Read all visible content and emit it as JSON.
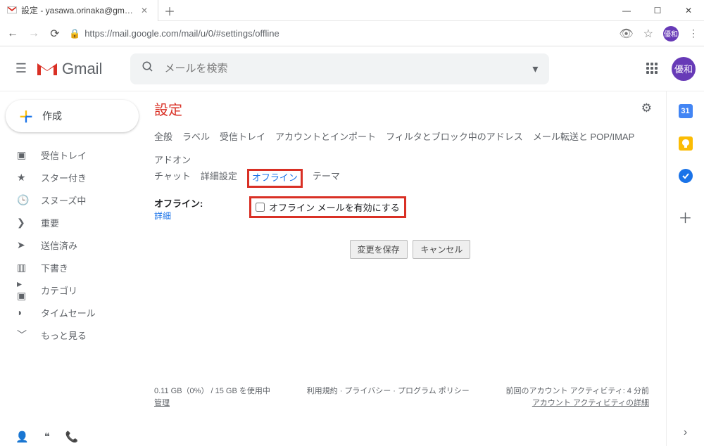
{
  "browser": {
    "tab_title": "設定 - yasawa.orinaka@gmail.co",
    "url": "https://mail.google.com/mail/u/0/#settings/offline",
    "avatar_text": "優和"
  },
  "header": {
    "product": "Gmail",
    "search_placeholder": "メールを検索",
    "avatar_text": "優和"
  },
  "compose": {
    "label": "作成"
  },
  "sidebar": {
    "items": [
      {
        "icon": "inbox",
        "label": "受信トレイ"
      },
      {
        "icon": "star",
        "label": "スター付き"
      },
      {
        "icon": "clock",
        "label": "スヌーズ中"
      },
      {
        "icon": "important",
        "label": "重要"
      },
      {
        "icon": "sent",
        "label": "送信済み"
      },
      {
        "icon": "draft",
        "label": "下書き"
      },
      {
        "icon": "category",
        "label": "カテゴリ"
      },
      {
        "icon": "label",
        "label": "タイムセール"
      },
      {
        "icon": "more",
        "label": "もっと見る"
      }
    ]
  },
  "settings": {
    "title": "設定",
    "tabs": {
      "general": "全般",
      "labels": "ラベル",
      "inbox": "受信トレイ",
      "accounts": "アカウントとインポート",
      "filters": "フィルタとブロック中のアドレス",
      "forwarding": "メール転送と POP/IMAP",
      "addons": "アドオン",
      "chat": "チャット",
      "advanced": "詳細設定",
      "offline": "オフライン",
      "themes": "テーマ"
    },
    "offline": {
      "label": "オフライン:",
      "detail_link": "詳細",
      "checkbox_label": "オフライン メールを有効にする",
      "checked": false
    },
    "buttons": {
      "save": "変更を保存",
      "cancel": "キャンセル"
    },
    "footer": {
      "storage": "0.11 GB（0%） / 15 GB を使用中",
      "manage": "管理",
      "policies": "利用規約 · プライバシー · プログラム ポリシー",
      "activity1": "前回のアカウント アクティビティ: 4 分前",
      "activity2": "アカウント アクティビティの詳細"
    }
  },
  "sidepanel": {
    "cal": "31"
  }
}
